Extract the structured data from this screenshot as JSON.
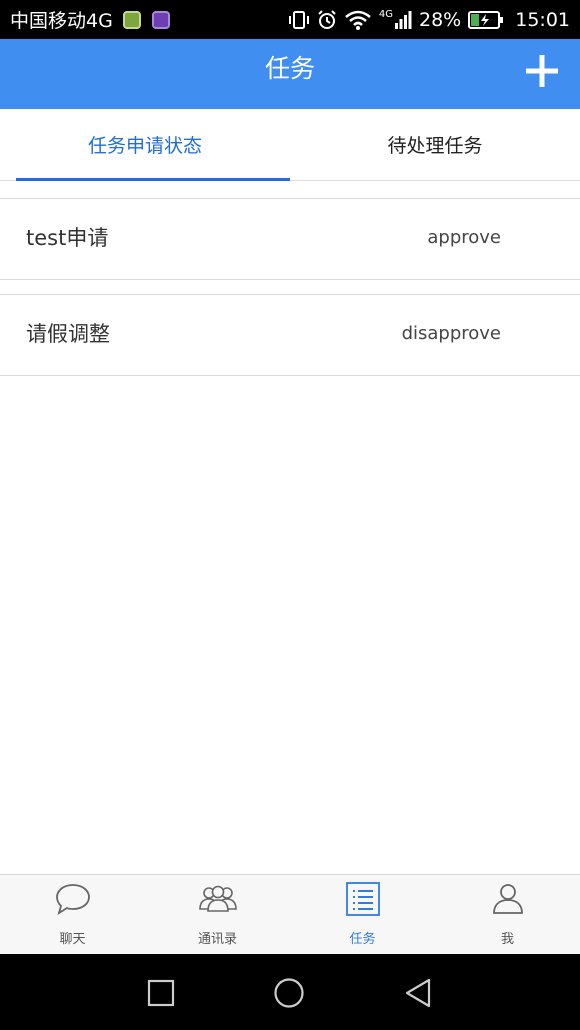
{
  "status_bar": {
    "carrier": "中国移动4G",
    "network_badge": "4G",
    "battery_percent": "28%",
    "time": "15:01"
  },
  "app_bar": {
    "title": "任务"
  },
  "tabs": [
    {
      "label": "任务申请状态",
      "active": true
    },
    {
      "label": "待处理任务",
      "active": false
    }
  ],
  "task_list": [
    {
      "title": "test申请",
      "status": "approve"
    },
    {
      "title": "请假调整",
      "status": "disapprove"
    }
  ],
  "bottom_nav": [
    {
      "label": "聊天",
      "icon": "chat-bubble-icon",
      "active": false
    },
    {
      "label": "通讯录",
      "icon": "contacts-icon",
      "active": false
    },
    {
      "label": "任务",
      "icon": "task-list-icon",
      "active": true
    },
    {
      "label": "我",
      "icon": "profile-icon",
      "active": false
    }
  ],
  "colors": {
    "app_bar": "#3f8ef0",
    "active_tab": "#1f6fd6",
    "active_nav": "#2f7de1"
  }
}
